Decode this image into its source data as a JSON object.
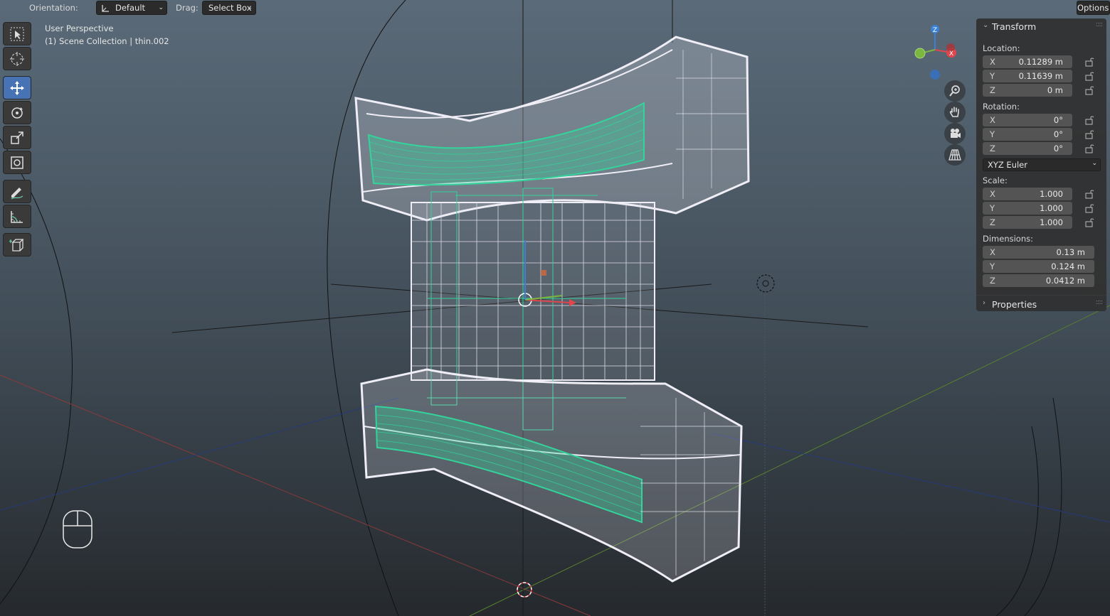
{
  "header": {
    "orientation_label": "Orientation:",
    "orientation_value": "Default",
    "drag_label": "Drag:",
    "drag_value": "Select Box",
    "options_label": "Options"
  },
  "viewport": {
    "view_name": "User Perspective",
    "collection_object": "(1) Scene Collection | thin.002"
  },
  "toolbar": {
    "tools": [
      {
        "name": "select-box-tool",
        "icon": "cursor-box-icon",
        "active": false
      },
      {
        "name": "cursor-tool",
        "icon": "3d-cursor-icon",
        "active": false
      },
      {
        "name": "move-tool",
        "icon": "move-arrows-icon",
        "active": true
      },
      {
        "name": "rotate-tool",
        "icon": "rotate-icon",
        "active": false
      },
      {
        "name": "scale-tool",
        "icon": "scale-icon",
        "active": false
      },
      {
        "name": "transform-tool",
        "icon": "transform-icon",
        "active": false
      },
      {
        "name": "annotate-tool",
        "icon": "pencil-icon",
        "active": false
      },
      {
        "name": "measure-tool",
        "icon": "ruler-icon",
        "active": false
      },
      {
        "name": "add-cube-tool",
        "icon": "cube-add-icon",
        "active": false
      }
    ]
  },
  "gizmo": {
    "axes": {
      "x": "X",
      "y": "Y",
      "z": "Z"
    },
    "colors": {
      "x": "#e0464e",
      "y": "#7ab640",
      "z": "#3b82d6"
    },
    "nav_buttons": [
      "zoom-icon",
      "hand-pan-icon",
      "camera-icon",
      "grid-perspective-icon"
    ]
  },
  "npanel": {
    "transform": {
      "title": "Transform",
      "location_label": "Location:",
      "location": [
        {
          "axis": "X",
          "value": "0.11289 m"
        },
        {
          "axis": "Y",
          "value": "0.11639 m"
        },
        {
          "axis": "Z",
          "value": "0 m"
        }
      ],
      "rotation_label": "Rotation:",
      "rotation": [
        {
          "axis": "X",
          "value": "0°"
        },
        {
          "axis": "Y",
          "value": "0°"
        },
        {
          "axis": "Z",
          "value": "0°"
        }
      ],
      "rotation_mode": "XYZ Euler",
      "scale_label": "Scale:",
      "scale": [
        {
          "axis": "X",
          "value": "1.000"
        },
        {
          "axis": "Y",
          "value": "1.000"
        },
        {
          "axis": "Z",
          "value": "1.000"
        }
      ],
      "dimensions_label": "Dimensions:",
      "dimensions": [
        {
          "axis": "X",
          "value": "0.13 m"
        },
        {
          "axis": "Y",
          "value": "0.124 m"
        },
        {
          "axis": "Z",
          "value": "0.0412 m"
        }
      ]
    },
    "properties_title": "Properties"
  },
  "colors": {
    "selection_green": "#34d39b",
    "wire_white": "#e9e6f0",
    "active_tool_blue": "#4772b3"
  }
}
